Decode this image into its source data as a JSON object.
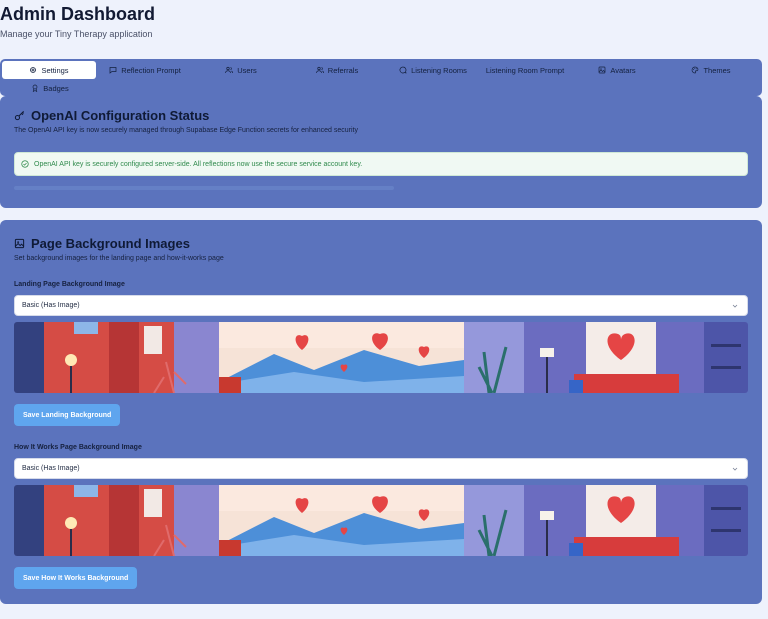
{
  "header": {
    "title": "Admin Dashboard",
    "subtitle": "Manage your Tiny Therapy application"
  },
  "tabs": [
    {
      "label": "Settings",
      "icon": "gear-icon",
      "active": true
    },
    {
      "label": "Reflection Prompt",
      "icon": "message-square-icon"
    },
    {
      "label": "Users",
      "icon": "users-icon"
    },
    {
      "label": "Referrals",
      "icon": "user-plus-icon"
    },
    {
      "label": "Listening Rooms",
      "icon": "message-circle-icon"
    },
    {
      "label": "Listening Room Prompt",
      "icon": ""
    },
    {
      "label": "Avatars",
      "icon": "image-icon"
    },
    {
      "label": "Themes",
      "icon": "palette-icon"
    },
    {
      "label": "Badges",
      "icon": "award-icon"
    }
  ],
  "openai": {
    "title": "OpenAI Configuration Status",
    "description": "The OpenAI API key is now securely managed through Supabase Edge Function secrets for enhanced security",
    "alert": "OpenAI API key is securely configured server-side. All reflections now use the secure service account key."
  },
  "backgrounds": {
    "title": "Page Background Images",
    "description": "Set background images for the landing page and how-it-works page",
    "landing": {
      "label": "Landing Page Background Image",
      "selected": "Basic (Has Image)",
      "button": "Save Landing Background"
    },
    "how_it_works": {
      "label": "How It Works Page Background Image",
      "selected": "Basic (Has Image)",
      "button": "Save How It Works Background"
    }
  },
  "colors": {
    "card_bg": "#5b73bd",
    "page_bg": "#eef2fc",
    "button_bg": "#5fa5ee",
    "alert_text": "#2f8a4c"
  }
}
